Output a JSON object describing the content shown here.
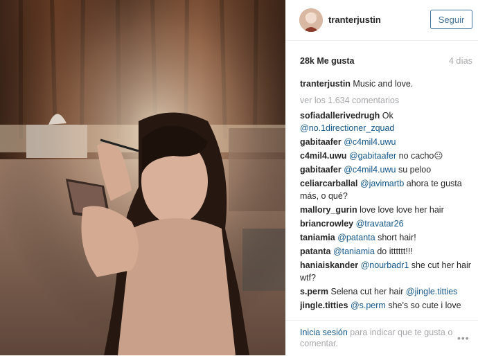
{
  "post": {
    "username": "tranterjustin",
    "follow_label": "Seguir",
    "likes": "28k Me gusta",
    "time": "4 días",
    "caption_user": "tranterjustin",
    "caption_text": "Music and love.",
    "view_all": "ver los 1.634 comentarios"
  },
  "comments": [
    {
      "user": "sofiadallerivedrugh",
      "mention": "",
      "text": "Ok",
      "after_mention": "@no.1directioner_zquad"
    },
    {
      "user": "gabitaafer",
      "mention": "@c4mil4.uwu",
      "text": "",
      "after_mention": ""
    },
    {
      "user": "c4mil4.uwu",
      "mention": "@gabitaafer",
      "text": "no cacho☹",
      "after_mention": ""
    },
    {
      "user": "gabitaafer",
      "mention": "@c4mil4.uwu",
      "text": "su peloo",
      "after_mention": ""
    },
    {
      "user": "celiarcarballal",
      "mention": "@javimartb",
      "text": "ahora te gusta más, o qué?",
      "after_mention": ""
    },
    {
      "user": "mallory_gurin",
      "mention": "",
      "text": "love love love her hair",
      "after_mention": ""
    },
    {
      "user": "briancrowley",
      "mention": "@travatar26",
      "text": "",
      "after_mention": ""
    },
    {
      "user": "taniamia",
      "mention": "@patanta",
      "text": "short hair!",
      "after_mention": ""
    },
    {
      "user": "patanta",
      "mention": "@taniamia",
      "text": "do itttttt!!!",
      "after_mention": ""
    },
    {
      "user": "haniaiskander",
      "mention": "@nourbadr1",
      "text": "she cut her hair wtf?",
      "after_mention": ""
    },
    {
      "user": "s.perm",
      "mention": "",
      "text": "Selena cut her hair",
      "after_mention": "@jingle.titties"
    },
    {
      "user": "jingle.titties",
      "mention": "@s.perm",
      "text": "she's so cute i love",
      "after_mention": ""
    }
  ],
  "footer": {
    "login_link": "Inicia sesión",
    "login_text": " para indicar que te gusta o comentar.",
    "more_icon": "more-options-icon"
  },
  "colors": {
    "link": "#125688",
    "follow": "#3f729b",
    "muted": "#a5a7aa"
  }
}
